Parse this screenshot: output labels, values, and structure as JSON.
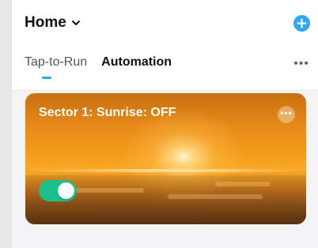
{
  "header": {
    "title": "Home",
    "add_icon": "plus-circle-icon",
    "chevron_icon": "chevron-down-icon"
  },
  "tabs": [
    {
      "label": "Tap-to-Run",
      "active": false
    },
    {
      "label": "Automation",
      "active": true
    }
  ],
  "tabs_more_label": "•••",
  "automation": {
    "title": "Sector 1: Sunrise: OFF",
    "more_label": "•••",
    "enabled": true
  },
  "colors": {
    "accent": "#2ea7f4",
    "toggle_on": "#19c08a"
  }
}
